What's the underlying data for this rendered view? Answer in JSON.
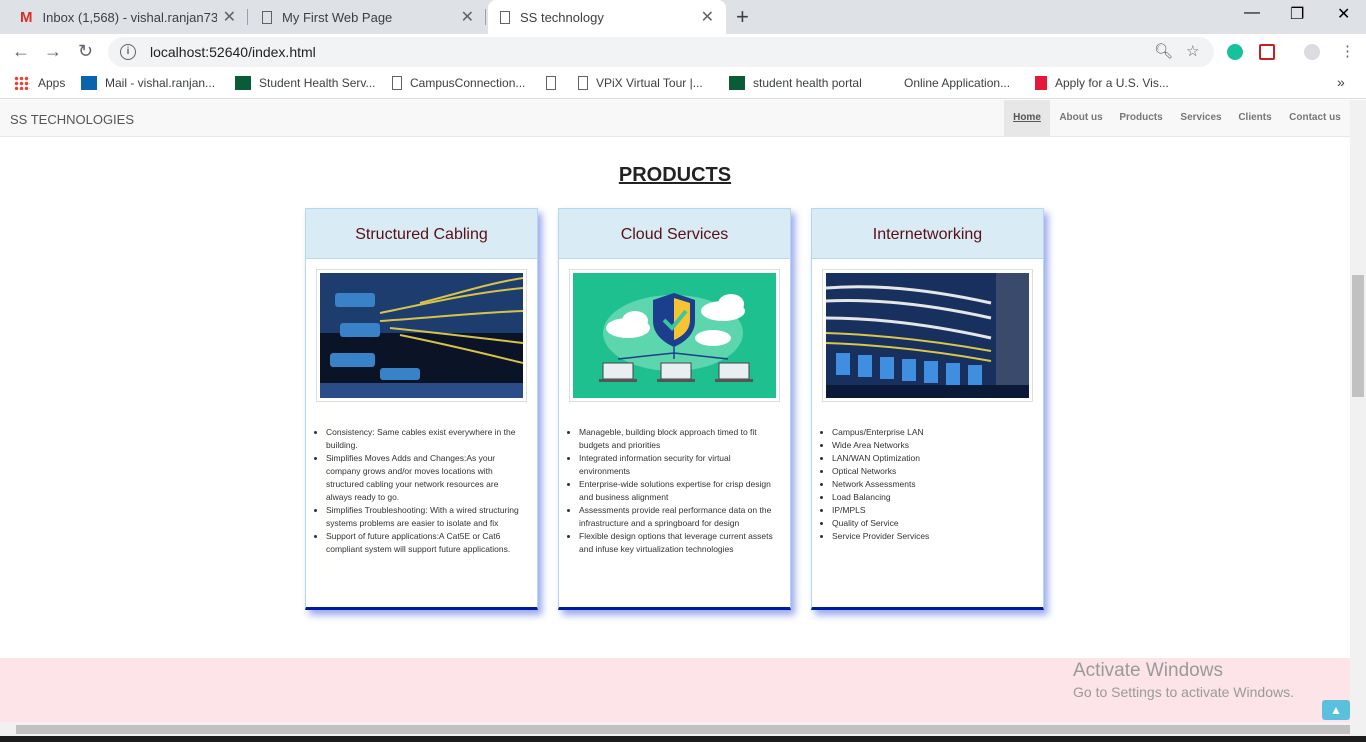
{
  "browser": {
    "tabs": [
      {
        "title": "Inbox (1,568) - vishal.ranjan7313",
        "icon": "gmail-icon"
      },
      {
        "title": "My First Web Page",
        "icon": "page-icon"
      },
      {
        "title": "SS technology",
        "icon": "page-icon",
        "active": true
      }
    ],
    "new_tab": "+",
    "url": "localhost:52640/index.html",
    "bookmarks": [
      {
        "label": "Apps"
      },
      {
        "label": "Mail - vishal.ranjan..."
      },
      {
        "label": "Student Health Serv..."
      },
      {
        "label": "CampusConnection..."
      },
      {
        "label": ""
      },
      {
        "label": "VPiX Virtual Tour |..."
      },
      {
        "label": "student health portal"
      },
      {
        "label": "Online Application..."
      },
      {
        "label": "Apply for a U.S. Vis..."
      }
    ],
    "more": "»"
  },
  "site": {
    "brand": "SS TECHNOLOGIES",
    "nav": [
      "Home",
      "About us",
      "Products",
      "Services",
      "Clients",
      "Contact us"
    ]
  },
  "products": {
    "title": "PRODUCTS",
    "cards": [
      {
        "title": "Structured Cabling",
        "image": "network-cables-image",
        "items": [
          "Consistency: Same cables exist everywhere in the building.",
          "Simplifies Moves Adds and Changes:As your company grows and/or moves locations with structured cabling your network resources are always ready to go.",
          "Simplifies Troubleshooting: With a wired structuring systems problems are easier to isolate and fix",
          "Support of future applications:A Cat5E or Cat6 compliant system will support future applications."
        ]
      },
      {
        "title": "Cloud Services",
        "image": "cloud-security-image",
        "items": [
          "Manageble, building block approach timed to fit budgets and priorities",
          "Integrated information security for virtual environments",
          "Enterprise-wide solutions expertise for crisp design and business alignment",
          "Assessments provide real performance data on the infrastructure and a springboard for design",
          "Flexible design options that leverage current assets and infuse key virtualization technologies"
        ]
      },
      {
        "title": "Internetworking",
        "image": "switch-cables-image",
        "items": [
          "Campus/Enterprise LAN",
          "Wide Area Networks",
          "LAN/WAN Optimization",
          "Optical Networks",
          "Network Assessments",
          "Load Balancing",
          "IP/MPLS",
          "Quality of Service",
          "Service Provider Services"
        ]
      }
    ]
  },
  "watermark": {
    "line1": "Activate Windows",
    "line2": "Go to Settings to activate Windows."
  },
  "colors": {
    "card_header_bg": "#d9ecf6",
    "card_title": "#5a0f14",
    "card_bottom_border": "#001a99",
    "footer_band": "#fce4e8",
    "back_to_top": "#5bc0de"
  }
}
